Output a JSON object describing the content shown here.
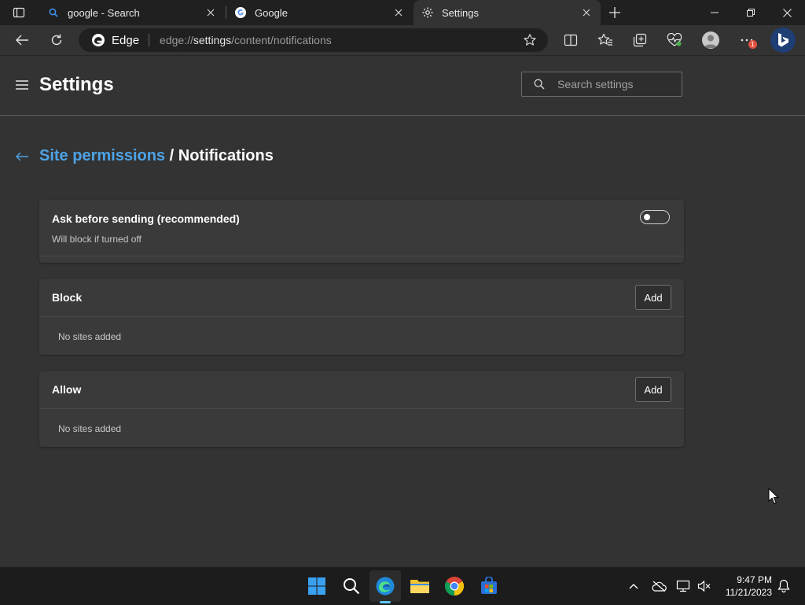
{
  "tabs": [
    {
      "title": "google - Search",
      "icon": "search-favicon"
    },
    {
      "title": "Google",
      "icon": "google-favicon"
    },
    {
      "title": "Settings",
      "icon": "gear-icon",
      "active": true
    }
  ],
  "toolbar": {
    "browser_label": "Edge",
    "url_scheme": "edge://",
    "url_host": "settings",
    "url_path": "/content/notifications",
    "notification_badge": "1"
  },
  "settings": {
    "title": "Settings",
    "search_placeholder": "Search settings"
  },
  "breadcrumb": {
    "parent": "Site permissions",
    "separator": "/",
    "current": "Notifications"
  },
  "ask_before_sending": {
    "title": "Ask before sending (recommended)",
    "subtitle": "Will block if turned off",
    "enabled": false
  },
  "block": {
    "title": "Block",
    "add_label": "Add",
    "empty_text": "No sites added"
  },
  "allow": {
    "title": "Allow",
    "add_label": "Add",
    "empty_text": "No sites added"
  },
  "taskbar": {
    "apps": [
      "start-icon",
      "search-icon",
      "edge-icon",
      "file-explorer-icon",
      "chrome-icon",
      "store-icon"
    ],
    "time": "9:47 PM",
    "date": "11/21/2023"
  },
  "colors": {
    "accent_link": "#4da3e6",
    "background": "#333333",
    "card": "#3a3a3a"
  }
}
